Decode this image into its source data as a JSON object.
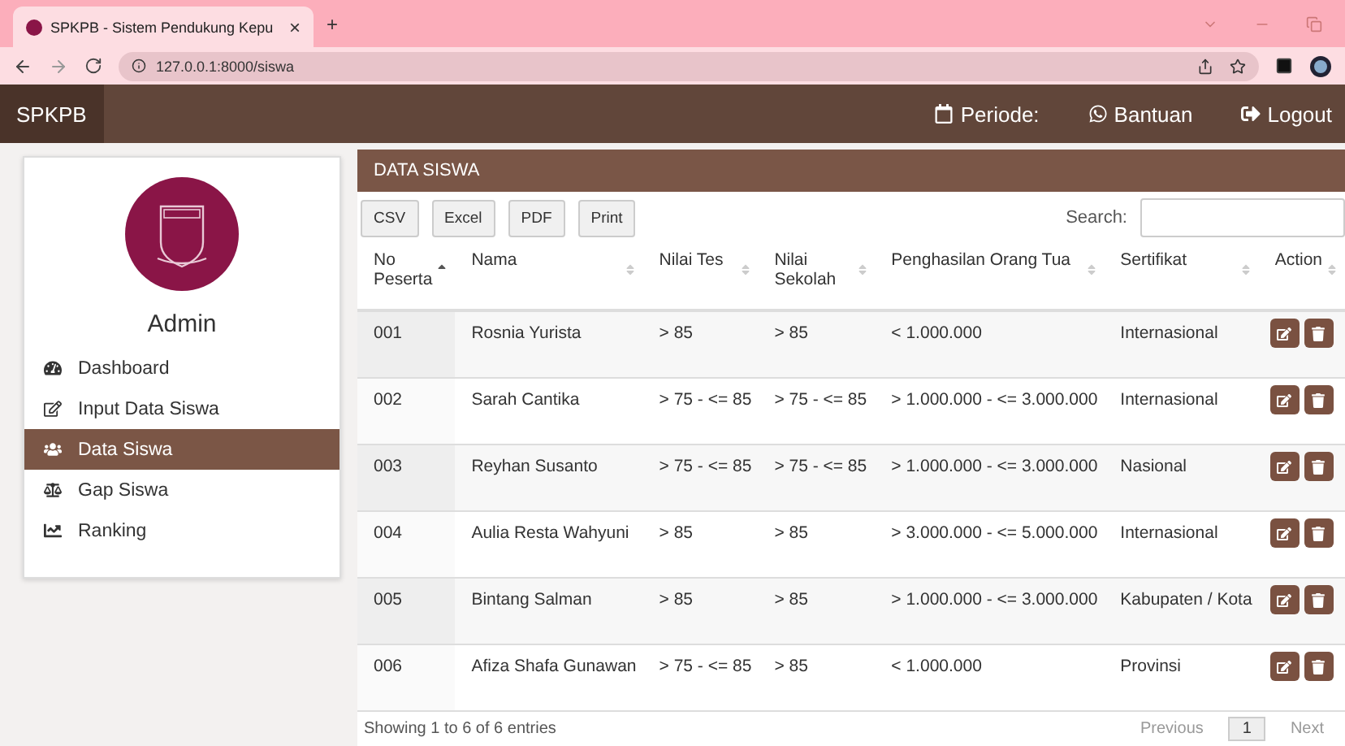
{
  "browser": {
    "tab_title": "SPKPB - Sistem Pendukung Kepu",
    "tab_close": "×",
    "new_tab": "+",
    "url": "127.0.0.1:8000/siswa"
  },
  "navbar": {
    "brand": "SPKPB",
    "items": [
      {
        "label": "Periode:"
      },
      {
        "label": "Bantuan"
      },
      {
        "label": "Logout"
      }
    ]
  },
  "sidebar": {
    "user": "Admin",
    "items": [
      {
        "label": "Dashboard",
        "selected": false
      },
      {
        "label": "Input Data Siswa",
        "selected": false
      },
      {
        "label": "Data Siswa",
        "selected": true
      },
      {
        "label": "Gap Siswa",
        "selected": false
      },
      {
        "label": "Ranking",
        "selected": false
      }
    ]
  },
  "panel": {
    "title": "DATA SISWA",
    "export_buttons": [
      "CSV",
      "Excel",
      "PDF",
      "Print"
    ],
    "search_label": "Search:",
    "table": {
      "columns": [
        {
          "label": "No Peserta",
          "sorted": true
        },
        {
          "label": "Nama",
          "sorted": false
        },
        {
          "label": "Nilai Tes",
          "sorted": false
        },
        {
          "label": "Nilai Sekolah",
          "sorted": false
        },
        {
          "label": "Penghasilan Orang Tua",
          "sorted": false
        },
        {
          "label": "Sertifikat",
          "sorted": false
        },
        {
          "label": "Action",
          "sorted": false
        }
      ],
      "rows": [
        {
          "cells": [
            "001",
            "Rosnia Yurista",
            "> 85",
            "> 85",
            "< 1.000.000",
            "Internasional"
          ]
        },
        {
          "cells": [
            "002",
            "Sarah Cantika",
            "> 75 - <= 85",
            "> 75 - <= 85",
            "> 1.000.000 - <= 3.000.000",
            "Internasional"
          ]
        },
        {
          "cells": [
            "003",
            "Reyhan Susanto",
            "> 75 - <= 85",
            "> 75 - <= 85",
            "> 1.000.000 - <= 3.000.000",
            "Nasional"
          ]
        },
        {
          "cells": [
            "004",
            "Aulia Resta Wahyuni",
            "> 85",
            "> 85",
            "> 3.000.000 - <= 5.000.000",
            "Internasional"
          ]
        },
        {
          "cells": [
            "005",
            "Bintang Salman",
            "> 85",
            "> 85",
            "> 1.000.000 - <= 3.000.000",
            "Kabupaten / Kota"
          ]
        },
        {
          "cells": [
            "006",
            "Afiza Shafa Gunawan",
            "> 75 - <= 85",
            "> 85",
            "< 1.000.000",
            "Provinsi"
          ]
        }
      ]
    },
    "footer": {
      "info": "Showing 1 to 6 of 6 entries",
      "pagination": [
        {
          "label": "Previous",
          "selected": false
        },
        {
          "label": "1",
          "selected": true
        },
        {
          "label": "Next",
          "selected": false
        }
      ]
    }
  }
}
